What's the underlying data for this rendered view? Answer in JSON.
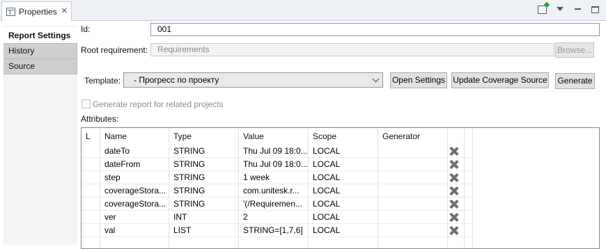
{
  "view": {
    "tab_title": "Properties",
    "tab_close": "✕"
  },
  "sidebar": {
    "tabs": [
      {
        "label": "Report Settings",
        "active": true
      },
      {
        "label": "History",
        "active": false
      },
      {
        "label": "Source",
        "active": false
      }
    ]
  },
  "form": {
    "id_label": "Id:",
    "id_value": "001",
    "root_label": "Root requirement:",
    "root_placeholder": "Requirements",
    "browse_label": "Browse...",
    "template_label": "Template:",
    "template_value": "- Прогресс по проекту",
    "open_settings_label": "Open Settings",
    "update_coverage_label": "Update Coverage Source",
    "generate_label": "Generate",
    "related_projects_label": "Generate report for related projects",
    "related_projects_checked": false,
    "attributes_label": "Attributes:"
  },
  "table": {
    "headers": [
      "L",
      "Name",
      "Type",
      "Value",
      "Scope",
      "Generator"
    ],
    "rows": [
      {
        "name": "dateTo",
        "type": "STRING",
        "value": "Thu Jul 09 18:0...",
        "scope": "LOCAL"
      },
      {
        "name": "dateFrom",
        "type": "STRING",
        "value": "Thu Jul 09 18:0...",
        "scope": "LOCAL"
      },
      {
        "name": "step",
        "type": "STRING",
        "value": "1 week",
        "scope": "LOCAL"
      },
      {
        "name": "coverageStora...",
        "type": "STRING",
        "value": "com.unitesk.r...",
        "scope": "LOCAL"
      },
      {
        "name": "coverageStora...",
        "type": "STRING",
        "value": "'(/Requiremen...",
        "scope": "LOCAL"
      },
      {
        "name": "ver",
        "type": "INT",
        "value": "2",
        "scope": "LOCAL"
      },
      {
        "name": "val",
        "type": "LIST",
        "value": "STRING=[1,7,6]",
        "scope": "LOCAL"
      }
    ]
  }
}
